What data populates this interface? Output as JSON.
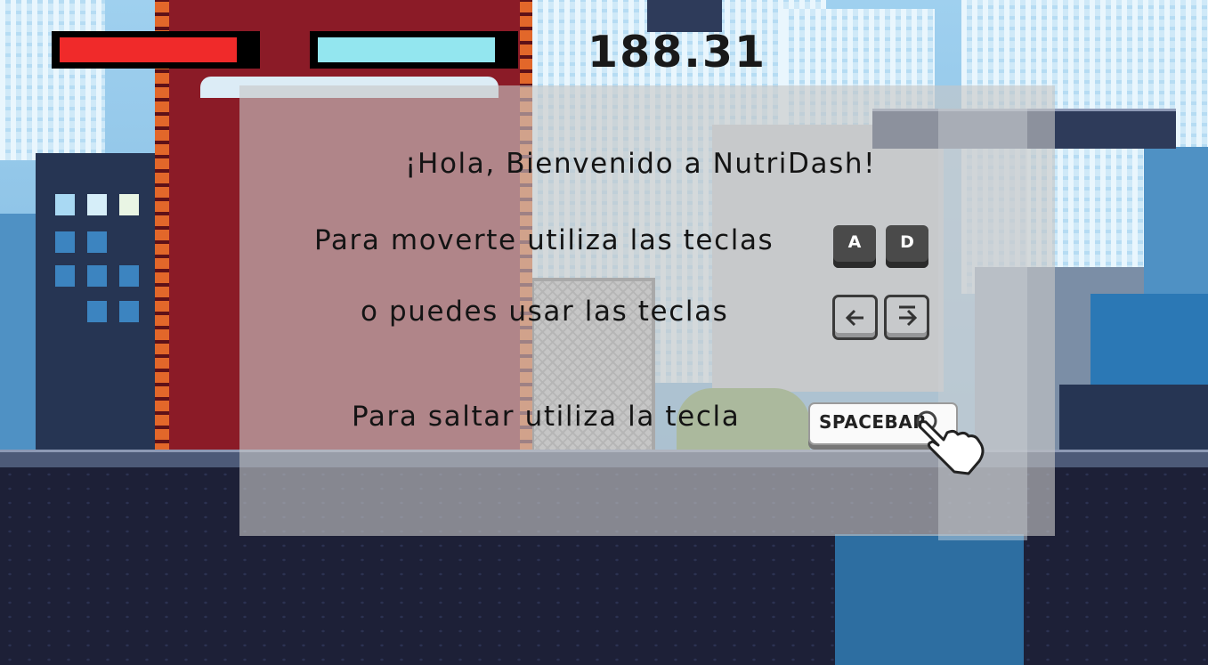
{
  "hud": {
    "health_fraction": 0.92,
    "energy_fraction": 0.92,
    "score": "188.31"
  },
  "tutorial": {
    "welcome": "¡Hola, Bienvenido a NutriDash!",
    "move_text": "Para moverte utiliza las teclas",
    "move_keys": [
      "A",
      "D"
    ],
    "alt_text": "o puedes usar las teclas",
    "alt_keys": [
      "left-arrow-icon",
      "right-arrow-icon"
    ],
    "jump_text": "Para saltar utiliza la tecla",
    "jump_key": "SPACEBAR"
  },
  "colors": {
    "health": "#f02a2a",
    "energy": "#93e6ef",
    "panel": "rgba(198,198,198,0.62)"
  }
}
